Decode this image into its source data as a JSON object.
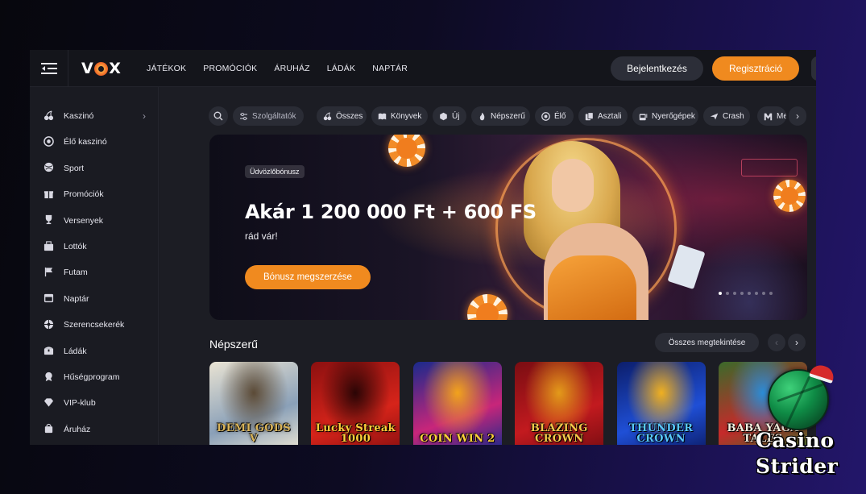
{
  "header": {
    "logo": "VOX",
    "nav": [
      "JÁTÉKOK",
      "PROMÓCIÓK",
      "ÁRUHÁZ",
      "LÁDÁK",
      "NAPTÁR"
    ],
    "login_label": "Bejelentkezés",
    "register_label": "Regisztráció"
  },
  "sidebar": {
    "items": [
      {
        "label": "Kaszinó",
        "icon": "cherries-icon",
        "has_submenu": true
      },
      {
        "label": "Élő kaszinó",
        "icon": "chip-icon"
      },
      {
        "label": "Sport",
        "icon": "ball-icon"
      },
      {
        "label": "Promóciók",
        "icon": "gift-icon"
      },
      {
        "label": "Versenyek",
        "icon": "trophy-icon"
      },
      {
        "label": "Lottók",
        "icon": "lottery-icon"
      },
      {
        "label": "Futam",
        "icon": "flag-icon"
      },
      {
        "label": "Naptár",
        "icon": "calendar-icon"
      },
      {
        "label": "Szerencsekerék",
        "icon": "wheel-icon"
      },
      {
        "label": "Ládák",
        "icon": "chest-icon"
      },
      {
        "label": "Hűségprogram",
        "icon": "loyalty-badge-icon"
      },
      {
        "label": "VIP-klub",
        "icon": "diamond-icon"
      },
      {
        "label": "Áruház",
        "icon": "shopping-bag-icon"
      }
    ]
  },
  "categories": {
    "search_icon": "search-icon",
    "providers_label": "Szolgáltatók",
    "items": [
      {
        "label": "Összes",
        "icon": "cherries-icon"
      },
      {
        "label": "Könyvek",
        "icon": "book-icon"
      },
      {
        "label": "Új",
        "icon": "cube-icon"
      },
      {
        "label": "Népszerű",
        "icon": "flame-icon"
      },
      {
        "label": "Élő",
        "icon": "chip-icon"
      },
      {
        "label": "Asztali",
        "icon": "cards-icon"
      },
      {
        "label": "Nyerőgépek",
        "icon": "slot-machine-icon"
      },
      {
        "label": "Crash",
        "icon": "plane-icon"
      },
      {
        "label": "Megaways",
        "icon": "m-icon"
      }
    ]
  },
  "banner": {
    "badge": "Üdvözlőbónusz",
    "headline": "Akár 1 200 000 Ft + 600 FS",
    "subline": "rád vár!",
    "cta_label": "Bónusz megszerzése",
    "slide_count": 8,
    "active_slide": 1
  },
  "popular": {
    "title": "Népszerű",
    "see_all_label": "Összes megtekintése",
    "games": [
      {
        "name": "DEMI GODS V",
        "colors": [
          "#e9e3d3",
          "#8aa0b8",
          "#5b4a36"
        ],
        "text_color": "#d9b45a"
      },
      {
        "name": "Lucky Streak 1000",
        "colors": [
          "#8c1010",
          "#d6241a",
          "#2a0505"
        ],
        "text_color": "#ffcf3a"
      },
      {
        "name": "COIN WIN 2",
        "colors": [
          "#1a2a8c",
          "#c8267a",
          "#f2a31c"
        ],
        "text_color": "#ffd23a"
      },
      {
        "name": "BLAZING CROWN",
        "colors": [
          "#7a0d12",
          "#c21a1f",
          "#e39a1a"
        ],
        "text_color": "#f5c84a"
      },
      {
        "name": "THUNDER CROWN",
        "colors": [
          "#0c1e6b",
          "#1f4fd6",
          "#f0b020"
        ],
        "text_color": "#58c8ff"
      },
      {
        "name": "BABA YAGA TALES",
        "colors": [
          "#3a6a2a",
          "#c62a2a",
          "#2a8cd6"
        ],
        "text_color": "#f6efe0"
      }
    ]
  },
  "watermark": {
    "line1": "Casino",
    "line2": "Strider"
  },
  "colors": {
    "accent": "#f08a1f",
    "panel": "#1a1b22",
    "pill": "#2a2c35"
  }
}
